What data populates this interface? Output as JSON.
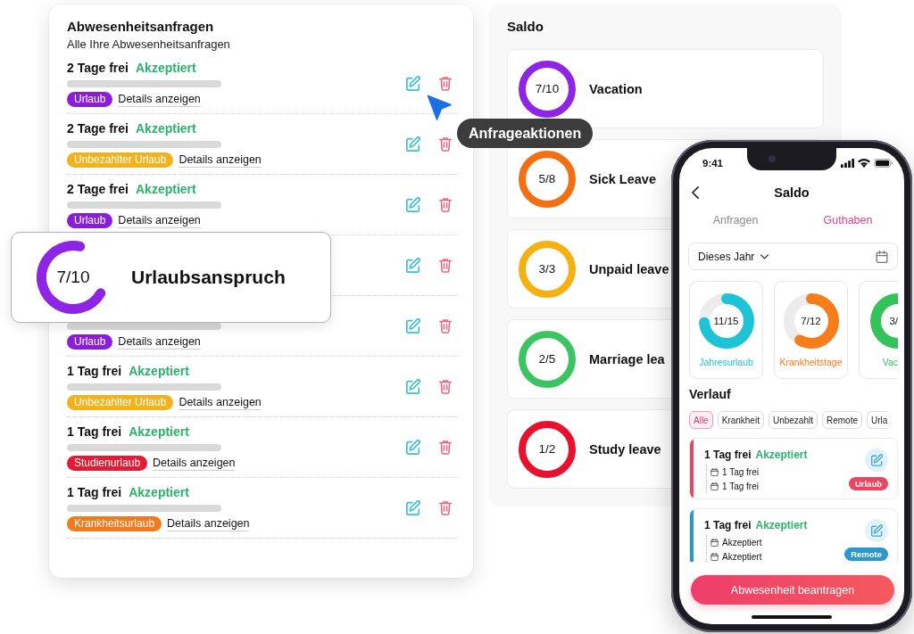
{
  "requests_panel": {
    "title": "Abwesenheitsanfragen",
    "subtitle": "Alle Ihre Abwesenheitsanfragen",
    "rows": [
      {
        "title": "2 Tage frei",
        "status": "Akzeptiert",
        "tag": {
          "label": "Urlaub",
          "color": "#8a1ed8"
        },
        "link": "Details anzeigen"
      },
      {
        "title": "2 Tage frei",
        "status": "Akzeptiert",
        "tag": {
          "label": "Unbezahlter Urlaub",
          "color": "#f3b21b"
        },
        "link": "Details anzeigen"
      },
      {
        "title": "2 Tage frei",
        "status": "Akzeptiert",
        "tag": {
          "label": "Urlaub",
          "color": "#8a1ed8"
        },
        "link": "Details anzeigen"
      },
      {},
      {
        "tag": {
          "label": "Urlaub",
          "color": "#8a1ed8"
        },
        "link": "Details anzeigen"
      },
      {
        "title": "1 Tag frei",
        "status": "Akzeptiert",
        "tag": {
          "label": "Unbezahlter Urlaub",
          "color": "#f3b21b"
        },
        "link": "Details anzeigen"
      },
      {
        "title": "1 Tag frei",
        "status": "Akzeptiert",
        "tag": {
          "label": "Studienurlaub",
          "color": "#e31b34"
        },
        "link": "Details anzeigen"
      },
      {
        "title": "1 Tag frei",
        "status": "Akzeptiert",
        "tag": {
          "label": "Krankheitsurlaub",
          "color": "#f27a1c"
        },
        "link": "Details anzeigen"
      }
    ]
  },
  "balance_panel": {
    "title": "Saldo",
    "items": [
      {
        "value": "7/10",
        "label": "Vacation",
        "color": "#8e24e4"
      },
      {
        "value": "5/8",
        "label": "Sick Leave",
        "color": "#f26f13"
      },
      {
        "value": "3/3",
        "label": "Unpaid leave",
        "color": "#f5b111"
      },
      {
        "value": "2/5",
        "label": "Marriage lea",
        "color": "#3cc463"
      },
      {
        "value": "1/2",
        "label": "Study leave",
        "color": "#e8112d"
      }
    ]
  },
  "summary_card": {
    "value": "7/10",
    "label": "Urlaubsanspruch",
    "level": 0.7
  },
  "tooltip": {
    "label": "Anfrageaktionen"
  },
  "phone": {
    "status_bar": {
      "time": "9:41"
    },
    "header": {
      "title": "Saldo"
    },
    "tabs": [
      {
        "label": "Anfragen",
        "selected": false
      },
      {
        "label": "Guthaben",
        "selected": true
      }
    ],
    "period_select": {
      "value": "Dieses Jahr"
    },
    "balance_cards": [
      {
        "value": "11/15",
        "label": "Jahresurlaub",
        "color": "#1ec3d6",
        "level": 0.733
      },
      {
        "value": "7/12",
        "label": "Krankheitstage",
        "color": "#f77c1a",
        "level": 0.583
      },
      {
        "value": "3/",
        "label": "Vac",
        "color": "#35c25a"
      }
    ],
    "history": {
      "title": "Verlauf",
      "filters": [
        {
          "label": "Alle",
          "selected": true
        },
        {
          "label": "Krankheit",
          "selected": false
        },
        {
          "label": "Unbezahlt",
          "selected": false
        },
        {
          "label": "Remote",
          "selected": false
        },
        {
          "label": "Urla",
          "selected": false
        }
      ],
      "entries": [
        {
          "title": "1 Tag frei",
          "status": "Akzeptiert",
          "color": "#e8475f",
          "details": [
            "1 Tag frei",
            "1 Tag frei"
          ],
          "tag": "Urlaub"
        },
        {
          "title": "1 Tag frei",
          "status": "Akzeptiert",
          "color": "#2b96cf",
          "details": [
            "Akzeptiert",
            "Akzeptiert"
          ],
          "tag": "Remote"
        }
      ]
    },
    "primary_button": {
      "label": "Abwesenheit beantragen"
    }
  }
}
